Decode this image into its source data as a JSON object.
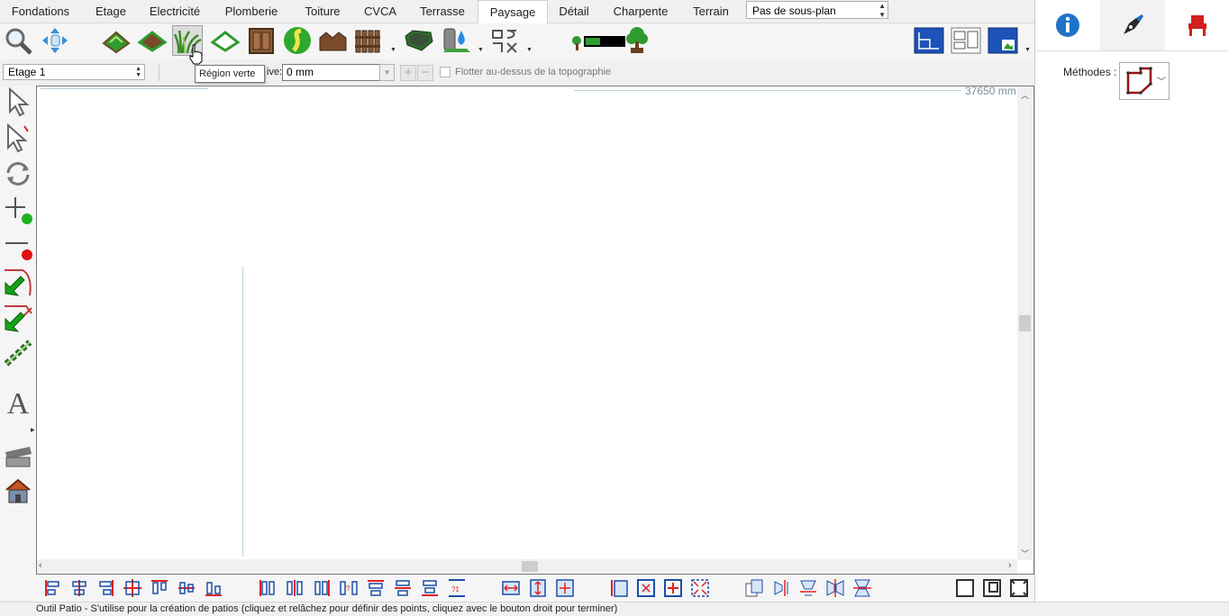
{
  "menu_tabs": [
    "Fondations",
    "Etage",
    "Electricité",
    "Plomberie",
    "Toiture",
    "CVCA",
    "Terrasse",
    "Paysage",
    "Détail",
    "Charpente",
    "Terrain"
  ],
  "active_tab": "Paysage",
  "subplan": {
    "value": "Pas de sous-plan"
  },
  "floor_selector": {
    "value": "Etage 1"
  },
  "tooltip": "Région verte",
  "elevation": {
    "label": "ive:",
    "value": "0 mm"
  },
  "float_checkbox": {
    "label": "Flotter au-dessus de la topographie",
    "checked": false
  },
  "ruler_text": "37650 mm",
  "right_panel": {
    "methods_label": "Méthodes :"
  },
  "status_text": "Outil Patio - S'utilise pour la création de patios (cliquez et relâchez pour définir des points, cliquez avec le bouton droit pour terminer)",
  "colors": {
    "accent": "#1e73c8",
    "green": "#1f9e1f",
    "red": "#e00000",
    "brown": "#7a4a2a"
  }
}
